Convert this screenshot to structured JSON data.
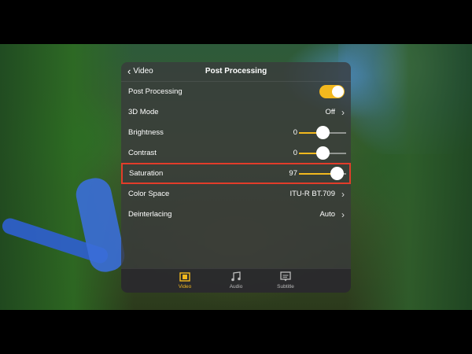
{
  "header": {
    "back_label": "Video",
    "title": "Post Processing"
  },
  "rows": [
    {
      "label": "Post Processing",
      "type": "toggle",
      "on": true
    },
    {
      "label": "3D Mode",
      "type": "select",
      "value": "Off"
    },
    {
      "label": "Brightness",
      "type": "slider",
      "value": "0",
      "level": 0.5
    },
    {
      "label": "Contrast",
      "type": "slider",
      "value": "0",
      "level": 0.5
    },
    {
      "label": "Saturation",
      "type": "slider",
      "value": "97",
      "level": 0.8,
      "highlighted": true
    },
    {
      "label": "Color Space",
      "type": "select",
      "value": "ITU-R BT.709"
    },
    {
      "label": "Deinterlacing",
      "type": "select",
      "value": "Auto"
    }
  ],
  "tabs": [
    {
      "label": "Video",
      "icon": "film-icon",
      "active": true
    },
    {
      "label": "Audio",
      "icon": "music-note-icon",
      "active": false
    },
    {
      "label": "Subtitle",
      "icon": "subtitle-icon",
      "active": false
    }
  ],
  "colors": {
    "accent": "#f2b81e",
    "highlight": "#e23c2a"
  }
}
